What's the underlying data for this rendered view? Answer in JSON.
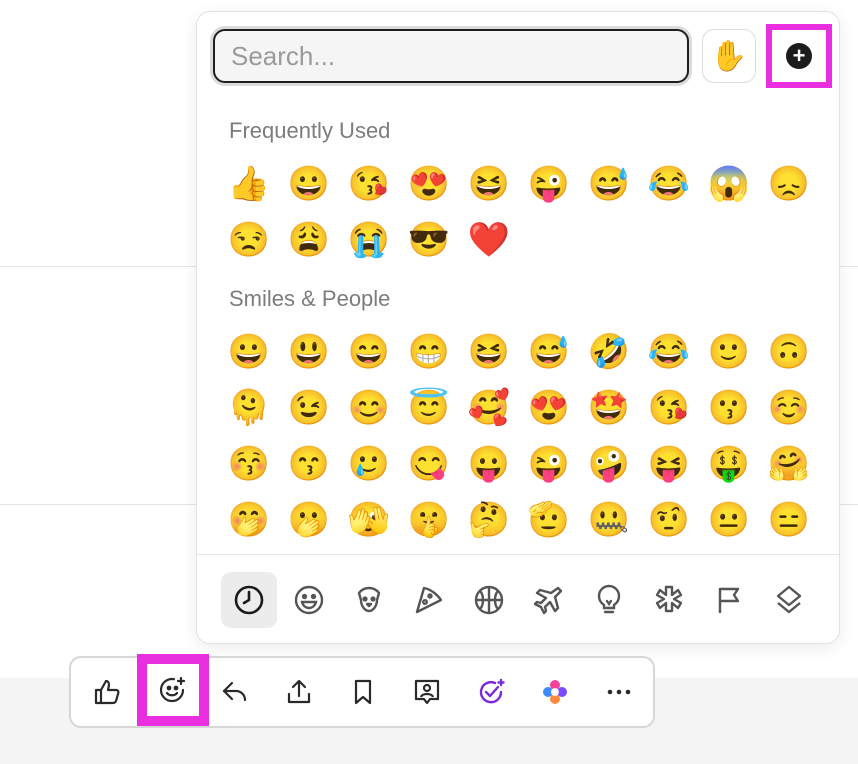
{
  "picker": {
    "search": {
      "placeholder": "Search...",
      "value": ""
    },
    "skin_tone_emoji": "✋",
    "add_icon_symbol": "+",
    "sections": [
      {
        "title": "Frequently Used",
        "emojis": [
          "👍",
          "😀",
          "😘",
          "😍",
          "😆",
          "😜",
          "😅",
          "😂",
          "😱",
          "😞",
          "😒",
          "😩",
          "😭",
          "😎",
          "❤️"
        ]
      },
      {
        "title": "Smiles & People",
        "emojis": [
          "😀",
          "😃",
          "😄",
          "😁",
          "😆",
          "😅",
          "🤣",
          "😂",
          "🙂",
          "🙃",
          "🫠",
          "😉",
          "😊",
          "😇",
          "🥰",
          "😍",
          "🤩",
          "😘",
          "😗",
          "☺️",
          "😚",
          "😙",
          "🥲",
          "😋",
          "😛",
          "😜",
          "🤪",
          "😝",
          "🤑",
          "🤗",
          "🤭",
          "🫢",
          "🫣",
          "🤫",
          "🤔",
          "🫡",
          "🤐",
          "🤨",
          "😐",
          "😑"
        ]
      }
    ],
    "categories": [
      "recent",
      "smileys",
      "animals",
      "food",
      "activity",
      "travel",
      "objects",
      "symbols",
      "flags",
      "custom"
    ],
    "active_category": "recent"
  },
  "colors": {
    "highlight": "#ea2fe0",
    "ai_purple": "#7b2bd9"
  }
}
